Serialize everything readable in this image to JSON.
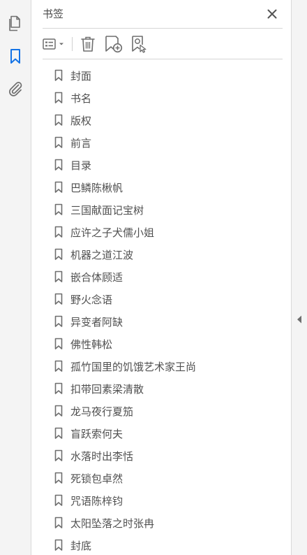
{
  "colors": {
    "accent": "#1473e6",
    "icon_gray": "#6e6e6e",
    "rail_bg": "#f4f4f4"
  },
  "rail": {
    "items": [
      {
        "icon": "page-thumbnails-icon"
      },
      {
        "icon": "bookmark-icon",
        "active": true
      },
      {
        "icon": "attachment-icon"
      }
    ]
  },
  "panel": {
    "title": "书签",
    "toolbar": {
      "options_icon": "options-menu-icon",
      "delete_icon": "trash-icon",
      "new_bookmark_icon": "add-bookmark-icon",
      "bookmark_from_structure_icon": "bookmark-search-icon"
    }
  },
  "bookmarks": [
    {
      "label": "封面"
    },
    {
      "label": "书名"
    },
    {
      "label": "版权"
    },
    {
      "label": "前言"
    },
    {
      "label": "目录"
    },
    {
      "label": "巴鳞陈楸帆"
    },
    {
      "label": "三国献面记宝树"
    },
    {
      "label": "应许之子犬儒小姐"
    },
    {
      "label": "机器之道江波"
    },
    {
      "label": "嵌合体顾适"
    },
    {
      "label": "野火念语"
    },
    {
      "label": "异变者阿缺"
    },
    {
      "label": "佛性韩松"
    },
    {
      "label": "孤竹国里的饥饿艺术家王尚"
    },
    {
      "label": "扣带回素梁清散"
    },
    {
      "label": "龙马夜行夏笳"
    },
    {
      "label": "盲跃索何夫"
    },
    {
      "label": "水落时出李恬"
    },
    {
      "label": "死锁包卓然"
    },
    {
      "label": "咒语陈梓钧"
    },
    {
      "label": "太阳坠落之时张冉"
    },
    {
      "label": "封底"
    }
  ]
}
